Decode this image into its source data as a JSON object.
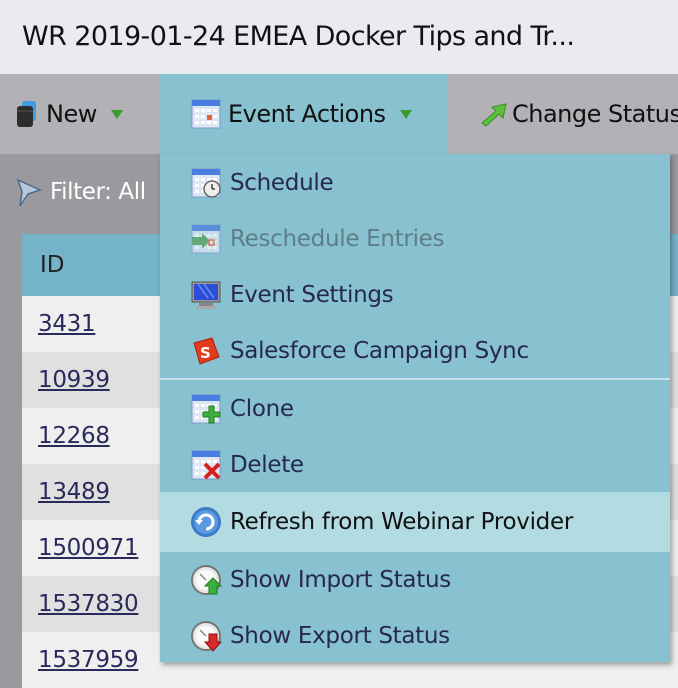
{
  "window": {
    "title": "WR 2019-01-24 EMEA Docker Tips and Tr..."
  },
  "toolbar": {
    "new_label": "New",
    "event_actions_label": "Event Actions",
    "change_status_label": "Change Status"
  },
  "filter": {
    "label": "Filter: All"
  },
  "table": {
    "column_header": "ID",
    "rows": [
      "3431",
      "10939",
      "12268",
      "13489",
      "1500971",
      "1537830",
      "1537959"
    ]
  },
  "menu": {
    "items": [
      {
        "label": "Schedule",
        "icon": "calendar-clock-icon",
        "enabled": true
      },
      {
        "label": "Reschedule Entries",
        "icon": "calendar-arrow-icon",
        "enabled": false
      },
      {
        "label": "Event Settings",
        "icon": "monitor-icon",
        "enabled": true
      },
      {
        "label": "Salesforce Campaign Sync",
        "icon": "salesforce-icon",
        "enabled": true
      },
      {
        "label": "Clone",
        "icon": "calendar-plus-icon",
        "enabled": true
      },
      {
        "label": "Delete",
        "icon": "calendar-delete-icon",
        "enabled": true
      },
      {
        "label": "Refresh from Webinar Provider",
        "icon": "refresh-icon",
        "enabled": true,
        "hovered": true
      },
      {
        "label": "Show Import Status",
        "icon": "import-status-icon",
        "enabled": true
      },
      {
        "label": "Show Export Status",
        "icon": "export-status-icon",
        "enabled": true
      }
    ]
  },
  "colors": {
    "menu_bg": "#88c1d0",
    "menu_hover": "#b3dbe2",
    "table_header": "#75b3c9",
    "link": "#2a2a5a"
  }
}
